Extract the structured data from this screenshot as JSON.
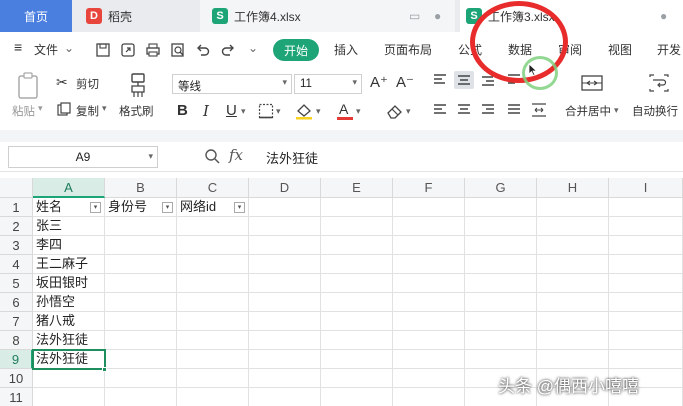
{
  "tabs": {
    "home": "首页",
    "daoke": "稻壳",
    "book4": "工作簿4.xlsx",
    "book3": "工作簿3.xlsx"
  },
  "menu": {
    "file": "文件",
    "items": [
      "开始",
      "插入",
      "页面布局",
      "公式",
      "数据",
      "审阅",
      "视图",
      "开发"
    ]
  },
  "ribbon": {
    "paste": "粘贴",
    "cut": "剪切",
    "copy": "复制",
    "format_painter": "格式刷",
    "font_name": "等线",
    "font_size": "11",
    "merge_center": "合并居中",
    "auto_wrap": "自动换行"
  },
  "formula_bar": {
    "cell_ref": "A9",
    "content": "法外狂徒"
  },
  "grid": {
    "columns": [
      "A",
      "B",
      "C",
      "D",
      "E",
      "F",
      "G",
      "H",
      "I"
    ],
    "rows": [
      "1",
      "2",
      "3",
      "4",
      "5",
      "6",
      "7",
      "8",
      "9",
      "10",
      "11"
    ],
    "headers": [
      "姓名",
      "身份号",
      "网络id"
    ],
    "names": [
      "张三",
      "李四",
      "王二麻子",
      "坂田银时",
      "孙悟空",
      "猪八戒",
      "法外狂徒",
      "法外狂徒"
    ]
  },
  "watermark": "头条 @偶西小嘻嘻",
  "colors": {
    "accent_green": "#1ea577",
    "home_tab_blue": "#4a7fe0",
    "annotation_red": "#e82c2c"
  }
}
